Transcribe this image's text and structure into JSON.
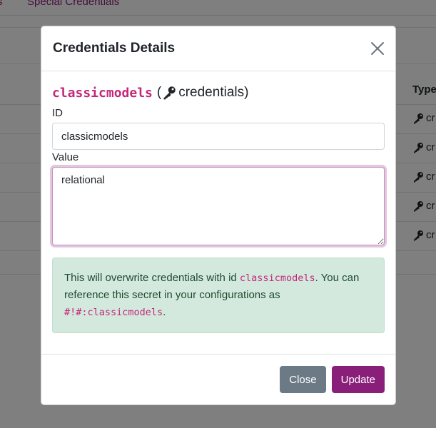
{
  "background": {
    "tabs": [
      "s",
      "Special Credentials"
    ],
    "table_header": "Type",
    "row_type_text": "cr",
    "row_count": 5
  },
  "modal": {
    "title": "Credentials Details",
    "heading": {
      "name": "classicmodels",
      "open_paren": "(",
      "suffix": "credentials)"
    },
    "id_label": "ID",
    "id_value": "classicmodels",
    "value_label": "Value",
    "value_text": "relational",
    "alert": {
      "part1": "This will overwrite credentials with id ",
      "id_code": "classicmodels",
      "part2": ". You can reference this secret in your configurations as ",
      "ref_code": "#!#:classicmodels",
      "part3": "."
    },
    "close_button": "Close",
    "update_button": "Update"
  },
  "colors": {
    "accent": "#8a1f7a",
    "code": "#c3277a",
    "alert_bg": "#d4e9dd",
    "close_button_bg": "#6c7a86"
  },
  "icons": [
    "key-icon",
    "close-icon"
  ]
}
